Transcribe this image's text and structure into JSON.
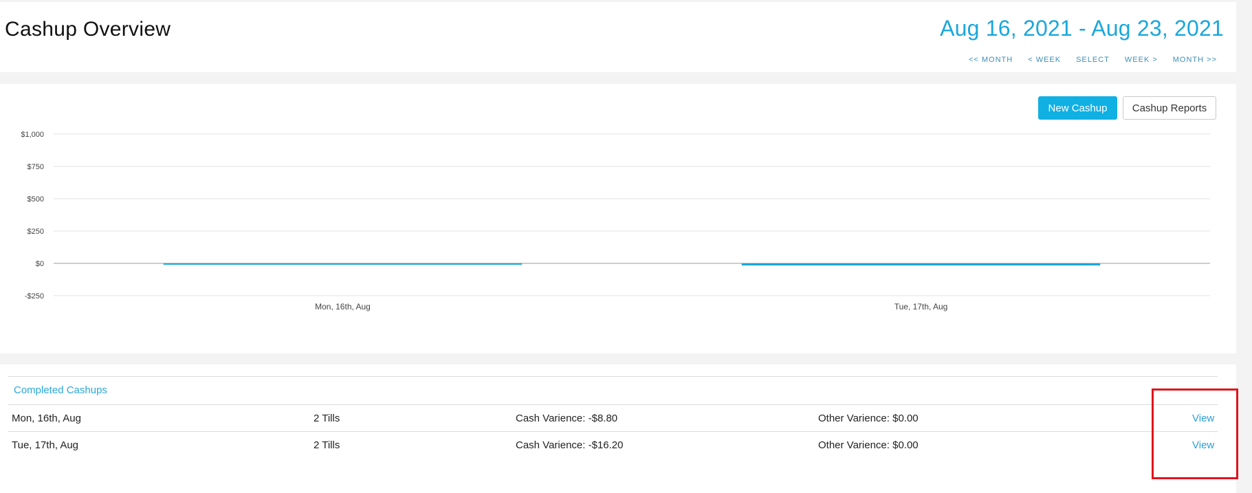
{
  "header": {
    "title": "Cashup Overview",
    "date_range": "Aug 16, 2021 - Aug 23, 2021",
    "nav": {
      "prev_month": "<< MONTH",
      "prev_week": "< WEEK",
      "select": "SELECT",
      "next_week": "WEEK >",
      "next_month": "MONTH >>"
    }
  },
  "toolbar": {
    "new_cashup_label": "New Cashup",
    "cashup_reports_label": "Cashup Reports"
  },
  "chart_data": {
    "type": "bar",
    "categories": [
      "Mon, 16th, Aug",
      "Tue, 17th, Aug"
    ],
    "values": [
      -8.8,
      -16.2
    ],
    "ylim": [
      -250,
      1000
    ],
    "yticks": [
      -250,
      0,
      250,
      500,
      750,
      1000
    ],
    "ytick_labels": [
      "-$250",
      "$0",
      "$250",
      "$500",
      "$750",
      "$1,000"
    ],
    "grid": true,
    "bar_color": "#1aa7dc",
    "title": "",
    "xlabel": "",
    "ylabel": ""
  },
  "completed": {
    "heading": "Completed Cashups",
    "rows": [
      {
        "date": "Mon, 16th, Aug",
        "tills": "2 Tills",
        "cash_variance": "Cash Varience: -$8.80",
        "other_variance": "Other Varience: $0.00",
        "action": "View"
      },
      {
        "date": "Tue, 17th, Aug",
        "tills": "2 Tills",
        "cash_variance": "Cash Varience: -$16.20",
        "other_variance": "Other Varience: $0.00",
        "action": "View"
      }
    ]
  },
  "colors": {
    "accent": "#1aa7dc",
    "primary_button": "#10b0e3",
    "highlight": "#e0131b"
  }
}
